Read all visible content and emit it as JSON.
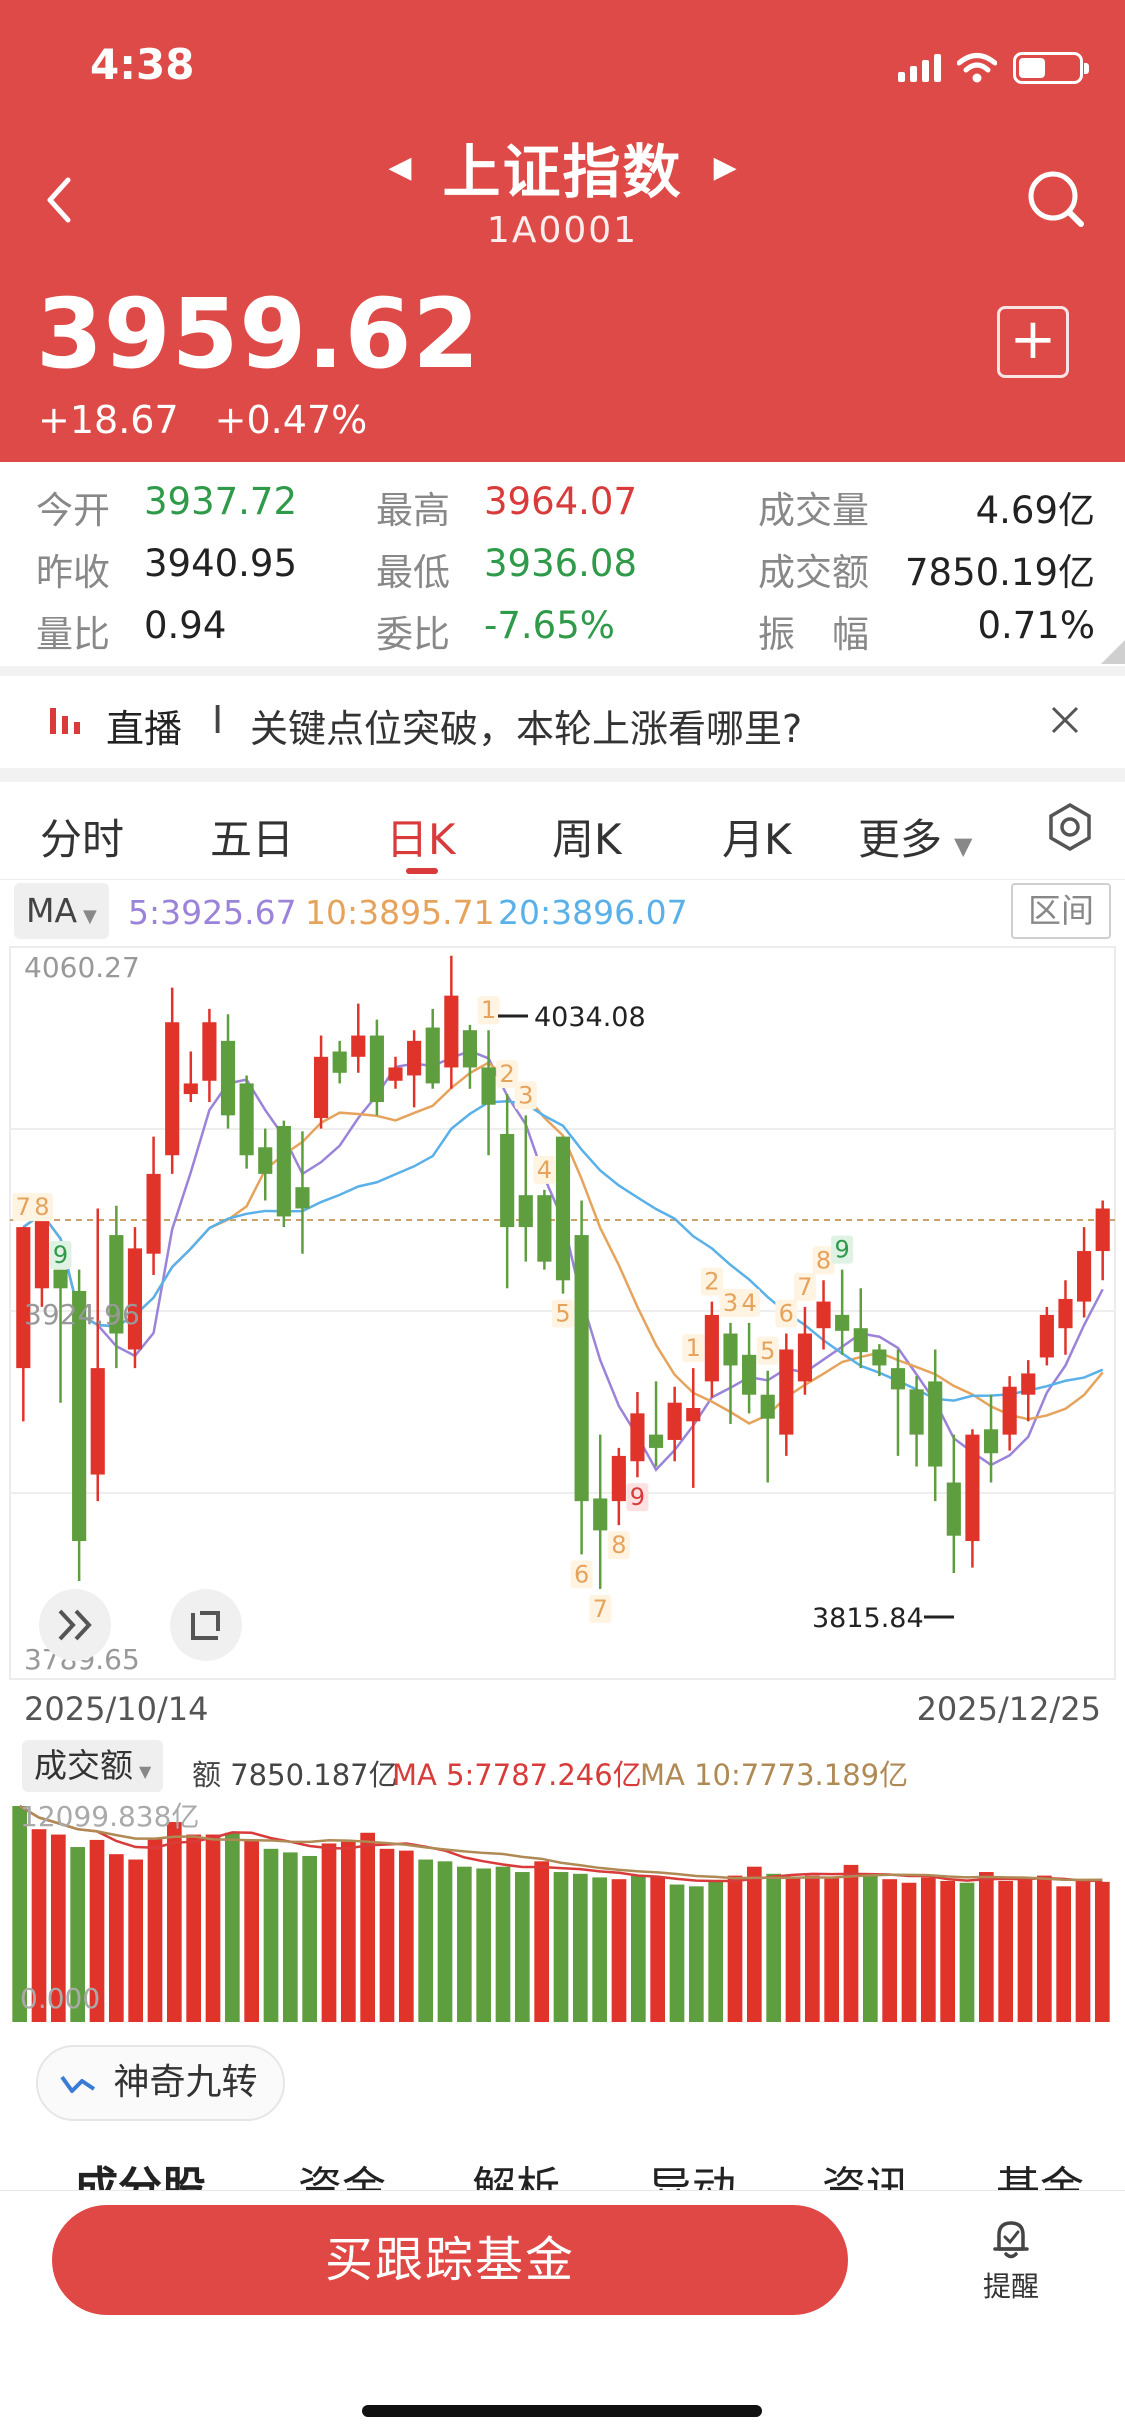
{
  "status_bar": {
    "time": "4:38"
  },
  "header": {
    "title": "上证指数",
    "code": "1A0001",
    "price": "3959.62",
    "change": "+18.67",
    "change_pct": "+0.47%"
  },
  "stats": {
    "open_label": "今开",
    "open": "3937.72",
    "high_label": "最高",
    "high": "3964.07",
    "volume_label": "成交量",
    "volume": "4.69亿",
    "prev_close_label": "昨收",
    "prev_close": "3940.95",
    "low_label": "最低",
    "low": "3936.08",
    "turnover_label": "成交额",
    "turnover": "7850.19亿",
    "volume_ratio_label": "量比",
    "volume_ratio": "0.94",
    "commission_ratio_label": "委比",
    "commission_ratio": "-7.65%",
    "amplitude_label": "振　幅",
    "amplitude": "0.71%"
  },
  "live": {
    "label": "直播",
    "divider": "I",
    "text": "关键点位突破，本轮上涨看哪里?"
  },
  "tabs": [
    "分时",
    "五日",
    "日K",
    "周K",
    "月K",
    "更多"
  ],
  "active_tab": "日K",
  "ma": {
    "selector": "MA",
    "ma5": "5:3925.67",
    "ma10": "10:3895.71",
    "ma20": "20:3896.07",
    "range_button": "区间"
  },
  "kchart_labels": {
    "top": "4060.27",
    "mid": "3924.96",
    "bottom": "3789.65",
    "max": "4034.08",
    "min": "3815.84",
    "start_date": "2025/10/14",
    "end_date": "2025/12/25"
  },
  "volume": {
    "selector": "成交额",
    "amount": "额 7850.187亿",
    "ma5": "MA 5:7787.246亿",
    "ma10": "MA 10:7773.189亿",
    "top_label": "12099.838亿",
    "zero_label": "0.000"
  },
  "magic_button": "神奇九转",
  "bottom_tabs": [
    "成分股",
    "资金",
    "解析",
    "异动",
    "资讯",
    "基金"
  ],
  "footer": {
    "buy_button": "买跟踪基金",
    "remind": "提醒"
  },
  "colors": {
    "header": "#dd4a47",
    "up": "#e0342b",
    "down": "#5e9e3f",
    "ma5": "#9b83d9",
    "ma10": "#e6a35c",
    "ma20": "#5ab0e8"
  },
  "chart_data": {
    "type": "candlestick",
    "ylim": [
      3789.65,
      4060.27
    ],
    "dates": [
      "2025/10/14",
      "2025/12/25"
    ],
    "candles": [
      [
        3905,
        3958,
        3885,
        3958
      ],
      [
        3935,
        3968,
        3928,
        3958
      ],
      [
        3942,
        3935,
        3892,
        3940
      ],
      [
        3934,
        3840,
        3825,
        3942
      ],
      [
        3865,
        3905,
        3855,
        3965
      ],
      [
        3955,
        3918,
        3905,
        3966
      ],
      [
        3912,
        3950,
        3905,
        3958
      ],
      [
        3948,
        3978,
        3940,
        3992
      ],
      [
        3985,
        4035,
        3978,
        4048
      ],
      [
        4008,
        4012,
        4005,
        4024
      ],
      [
        4013,
        4035,
        4005,
        4040
      ],
      [
        4028,
        4000,
        3995,
        4038
      ],
      [
        4012,
        3985,
        3980,
        4015
      ],
      [
        3988,
        3978,
        3968,
        3995
      ],
      [
        3996,
        3962,
        3958,
        3998
      ],
      [
        3973,
        3965,
        3948,
        3994
      ],
      [
        3999,
        4022,
        3995,
        4030
      ],
      [
        4024,
        4016,
        4012,
        4028
      ],
      [
        4022,
        4030,
        4016,
        4042
      ],
      [
        4030,
        4005,
        4000,
        4036
      ],
      [
        4013,
        4018,
        4010,
        4022
      ],
      [
        4015,
        4028,
        4003,
        4032
      ],
      [
        4033,
        4012,
        4010,
        4040
      ],
      [
        4018,
        4045,
        4010,
        4060
      ],
      [
        4032,
        4018,
        4010,
        4034
      ],
      [
        4018,
        4004,
        3985,
        4032
      ],
      [
        3993,
        3958,
        3935,
        4008
      ],
      [
        3970,
        3958,
        3945,
        4000
      ],
      [
        3970,
        3945,
        3942,
        3972
      ],
      [
        3992,
        3938,
        3933,
        3992
      ],
      [
        3955,
        3855,
        3835,
        3968
      ],
      [
        3856,
        3844,
        3822,
        3880
      ],
      [
        3855,
        3872,
        3846,
        3875
      ],
      [
        3870,
        3888,
        3864,
        3896
      ],
      [
        3880,
        3875,
        3868,
        3900
      ],
      [
        3878,
        3892,
        3870,
        3898
      ],
      [
        3885,
        3890,
        3860,
        3905
      ],
      [
        3900,
        3925,
        3894,
        3930
      ],
      [
        3918,
        3906,
        3884,
        3922
      ],
      [
        3910,
        3895,
        3888,
        3922
      ],
      [
        3895,
        3886,
        3862,
        3904
      ],
      [
        3880,
        3912,
        3872,
        3918
      ],
      [
        3900,
        3918,
        3895,
        3928
      ],
      [
        3920,
        3930,
        3912,
        3938
      ],
      [
        3925,
        3919,
        3910,
        3942
      ],
      [
        3920,
        3911,
        3905,
        3935
      ],
      [
        3912,
        3906,
        3902,
        3914
      ],
      [
        3905,
        3897,
        3872,
        3912
      ],
      [
        3897,
        3880,
        3868,
        3902
      ],
      [
        3900,
        3868,
        3855,
        3912
      ],
      [
        3862,
        3842,
        3828,
        3880
      ],
      [
        3840,
        3880,
        3830,
        3882
      ],
      [
        3882,
        3873,
        3862,
        3895
      ],
      [
        3880,
        3898,
        3874,
        3902
      ],
      [
        3895,
        3903,
        3885,
        3908
      ],
      [
        3909,
        3925,
        3906,
        3928
      ],
      [
        3920,
        3931,
        3910,
        3938
      ],
      [
        3930,
        3949,
        3924,
        3958
      ],
      [
        3949,
        3965,
        3938,
        3968
      ]
    ],
    "volume": [
      [
        12099,
        "down"
      ],
      [
        10800,
        "up"
      ],
      [
        10500,
        "up"
      ],
      [
        9800,
        "down"
      ],
      [
        10200,
        "up"
      ],
      [
        9400,
        "up"
      ],
      [
        9100,
        "up"
      ],
      [
        10300,
        "up"
      ],
      [
        11200,
        "up"
      ],
      [
        10500,
        "up"
      ],
      [
        10500,
        "up"
      ],
      [
        10600,
        "down"
      ],
      [
        10200,
        "up"
      ],
      [
        9700,
        "down"
      ],
      [
        9500,
        "down"
      ],
      [
        9300,
        "down"
      ],
      [
        10000,
        "up"
      ],
      [
        10100,
        "up"
      ],
      [
        10600,
        "up"
      ],
      [
        9700,
        "up"
      ],
      [
        9600,
        "up"
      ],
      [
        9100,
        "down"
      ],
      [
        9000,
        "down"
      ],
      [
        8700,
        "down"
      ],
      [
        8600,
        "down"
      ],
      [
        8700,
        "down"
      ],
      [
        8400,
        "down"
      ],
      [
        9000,
        "up"
      ],
      [
        8400,
        "down"
      ],
      [
        8300,
        "down"
      ],
      [
        8100,
        "down"
      ],
      [
        8000,
        "up"
      ],
      [
        8200,
        "down"
      ],
      [
        8100,
        "up"
      ],
      [
        7700,
        "down"
      ],
      [
        7600,
        "down"
      ],
      [
        7900,
        "down"
      ],
      [
        8200,
        "up"
      ],
      [
        8700,
        "up"
      ],
      [
        8300,
        "down"
      ],
      [
        8100,
        "up"
      ],
      [
        8200,
        "up"
      ],
      [
        8100,
        "up"
      ],
      [
        8800,
        "up"
      ],
      [
        8200,
        "down"
      ],
      [
        8000,
        "up"
      ],
      [
        7800,
        "up"
      ],
      [
        8100,
        "up"
      ],
      [
        7900,
        "up"
      ],
      [
        7800,
        "down"
      ],
      [
        8400,
        "up"
      ],
      [
        7900,
        "up"
      ],
      [
        8000,
        "up"
      ],
      [
        8200,
        "up"
      ],
      [
        7600,
        "up"
      ],
      [
        7900,
        "up"
      ],
      [
        7850,
        "up"
      ]
    ],
    "nine_turn_labels": [
      {
        "i": 0,
        "n": "7",
        "side": "up"
      },
      {
        "i": 1,
        "n": "8",
        "side": "up"
      },
      {
        "i": 2,
        "n": "9",
        "side": "sell"
      },
      {
        "i": 25,
        "n": "1",
        "side": "up"
      },
      {
        "i": 26,
        "n": "2",
        "side": "up"
      },
      {
        "i": 27,
        "n": "3",
        "side": "up"
      },
      {
        "i": 28,
        "n": "4",
        "side": "up"
      },
      {
        "i": 29,
        "n": "5",
        "side": "down"
      },
      {
        "i": 30,
        "n": "6",
        "side": "down"
      },
      {
        "i": 31,
        "n": "7",
        "side": "down"
      },
      {
        "i": 32,
        "n": "8",
        "side": "down"
      },
      {
        "i": 33,
        "n": "9",
        "side": "buy"
      },
      {
        "i": 36,
        "n": "1",
        "side": "up"
      },
      {
        "i": 37,
        "n": "2",
        "side": "up"
      },
      {
        "i": 38,
        "n": "3",
        "side": "up"
      },
      {
        "i": 39,
        "n": "4",
        "side": "up"
      },
      {
        "i": 40,
        "n": "5",
        "side": "up"
      },
      {
        "i": 41,
        "n": "6",
        "side": "up"
      },
      {
        "i": 42,
        "n": "7",
        "side": "up"
      },
      {
        "i": 43,
        "n": "8",
        "side": "up"
      },
      {
        "i": 44,
        "n": "9",
        "side": "sell"
      }
    ]
  }
}
